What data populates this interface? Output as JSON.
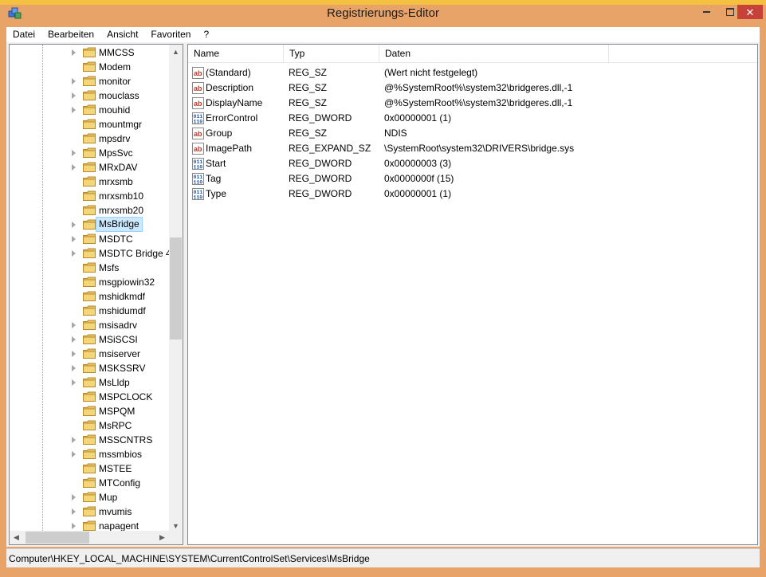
{
  "window": {
    "title": "Registrierungs-Editor",
    "minimize_label": "—",
    "maximize_label": "☐",
    "close_label": "✕"
  },
  "menu": [
    "Datei",
    "Bearbeiten",
    "Ansicht",
    "Favoriten",
    "?"
  ],
  "tree": {
    "items": [
      {
        "label": "MMCSS",
        "has_children": true
      },
      {
        "label": "Modem",
        "has_children": false
      },
      {
        "label": "monitor",
        "has_children": true
      },
      {
        "label": "mouclass",
        "has_children": true
      },
      {
        "label": "mouhid",
        "has_children": true
      },
      {
        "label": "mountmgr",
        "has_children": false
      },
      {
        "label": "mpsdrv",
        "has_children": false
      },
      {
        "label": "MpsSvc",
        "has_children": true
      },
      {
        "label": "MRxDAV",
        "has_children": true
      },
      {
        "label": "mrxsmb",
        "has_children": false
      },
      {
        "label": "mrxsmb10",
        "has_children": false
      },
      {
        "label": "mrxsmb20",
        "has_children": false
      },
      {
        "label": "MsBridge",
        "has_children": true,
        "selected": true
      },
      {
        "label": "MSDTC",
        "has_children": true
      },
      {
        "label": "MSDTC Bridge 4",
        "has_children": true
      },
      {
        "label": "Msfs",
        "has_children": false
      },
      {
        "label": "msgpiowin32",
        "has_children": false
      },
      {
        "label": "mshidkmdf",
        "has_children": false
      },
      {
        "label": "mshidumdf",
        "has_children": false
      },
      {
        "label": "msisadrv",
        "has_children": true
      },
      {
        "label": "MSiSCSI",
        "has_children": true
      },
      {
        "label": "msiserver",
        "has_children": true
      },
      {
        "label": "MSKSSRV",
        "has_children": true
      },
      {
        "label": "MsLldp",
        "has_children": true
      },
      {
        "label": "MSPCLOCK",
        "has_children": false
      },
      {
        "label": "MSPQM",
        "has_children": false
      },
      {
        "label": "MsRPC",
        "has_children": false
      },
      {
        "label": "MSSCNTRS",
        "has_children": true
      },
      {
        "label": "mssmbios",
        "has_children": true
      },
      {
        "label": "MSTEE",
        "has_children": false
      },
      {
        "label": "MTConfig",
        "has_children": false
      },
      {
        "label": "Mup",
        "has_children": true
      },
      {
        "label": "mvumis",
        "has_children": true
      },
      {
        "label": "napagent",
        "has_children": true
      }
    ],
    "folder_color": "#e8c060"
  },
  "list": {
    "columns": [
      "Name",
      "Typ",
      "Daten"
    ],
    "rows": [
      {
        "icon": "string-value-icon",
        "name": "(Standard)",
        "type": "REG_SZ",
        "data": "(Wert nicht festgelegt)"
      },
      {
        "icon": "string-value-icon",
        "name": "Description",
        "type": "REG_SZ",
        "data": "@%SystemRoot%\\system32\\bridgeres.dll,-1"
      },
      {
        "icon": "string-value-icon",
        "name": "DisplayName",
        "type": "REG_SZ",
        "data": "@%SystemRoot%\\system32\\bridgeres.dll,-1"
      },
      {
        "icon": "binary-value-icon",
        "name": "ErrorControl",
        "type": "REG_DWORD",
        "data": "0x00000001 (1)"
      },
      {
        "icon": "string-value-icon",
        "name": "Group",
        "type": "REG_SZ",
        "data": "NDIS"
      },
      {
        "icon": "string-value-icon",
        "name": "ImagePath",
        "type": "REG_EXPAND_SZ",
        "data": "\\SystemRoot\\system32\\DRIVERS\\bridge.sys"
      },
      {
        "icon": "binary-value-icon",
        "name": "Start",
        "type": "REG_DWORD",
        "data": "0x00000003 (3)"
      },
      {
        "icon": "binary-value-icon",
        "name": "Tag",
        "type": "REG_DWORD",
        "data": "0x0000000f (15)"
      },
      {
        "icon": "binary-value-icon",
        "name": "Type",
        "type": "REG_DWORD",
        "data": "0x00000001 (1)"
      }
    ]
  },
  "statusbar": {
    "path": "Computer\\HKEY_LOCAL_MACHINE\\SYSTEM\\CurrentControlSet\\Services\\MsBridge"
  },
  "colors": {
    "frame": "#e8a468",
    "close_button": "#c7413b",
    "selection_bg": "#cce8ff",
    "selection_border": "#99d1ff"
  }
}
